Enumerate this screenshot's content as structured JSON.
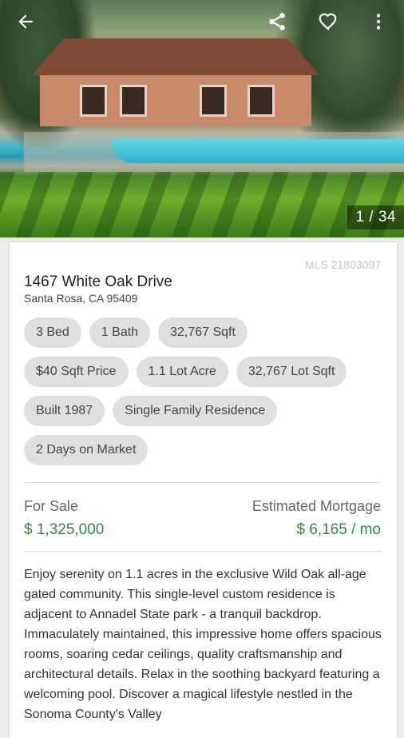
{
  "hero": {
    "photo_counter": "1 / 34",
    "icons": {
      "back": "arrow-back-icon",
      "share": "share-icon",
      "favorite": "heart-outline-icon",
      "more": "more-vert-icon"
    }
  },
  "listing": {
    "mls": "MLS 21803097",
    "address_line1": "1467 White Oak Drive",
    "address_line2": "Santa Rosa, CA 95409",
    "chips": [
      [
        "3 Bed",
        "1 Bath",
        "32,767 Sqft"
      ],
      [
        "$40 Sqft Price",
        "1.1 Lot Acre",
        "32,767 Lot Sqft"
      ],
      [
        "Built 1987",
        "Single Family Residence"
      ],
      [
        "2 Days on Market"
      ]
    ],
    "status_label": "For Sale",
    "price": "$ 1,325,000",
    "mortgage_label": "Estimated Mortgage",
    "mortgage": "$ 6,165 / mo",
    "description": "Enjoy serenity on 1.1 acres in the exclusive Wild Oak all-age gated community. This single-level custom residence is adjacent to Annadel State park - a tranquil backdrop. Immaculately maintained, this impressive home offers spacious rooms, soaring cedar ceilings, quality craftsmanship and architectural details. Relax in the soothing backyard featuring a welcoming pool. Discover a magical lifestyle nestled in the Sonoma County's Valley"
  },
  "colors": {
    "price_green": "#2f8a3e",
    "chip_bg": "#e0e0e0"
  }
}
